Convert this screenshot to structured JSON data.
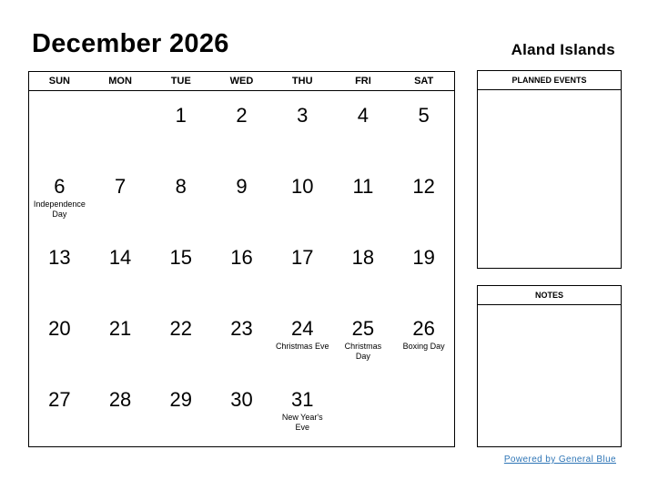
{
  "header": {
    "title": "December 2026",
    "country": "Aland Islands"
  },
  "weekdays": [
    "SUN",
    "MON",
    "TUE",
    "WED",
    "THU",
    "FRI",
    "SAT"
  ],
  "cells": [
    {
      "day": "",
      "holiday": ""
    },
    {
      "day": "",
      "holiday": ""
    },
    {
      "day": "1",
      "holiday": ""
    },
    {
      "day": "2",
      "holiday": ""
    },
    {
      "day": "3",
      "holiday": ""
    },
    {
      "day": "4",
      "holiday": ""
    },
    {
      "day": "5",
      "holiday": ""
    },
    {
      "day": "6",
      "holiday": "Independence Day"
    },
    {
      "day": "7",
      "holiday": ""
    },
    {
      "day": "8",
      "holiday": ""
    },
    {
      "day": "9",
      "holiday": ""
    },
    {
      "day": "10",
      "holiday": ""
    },
    {
      "day": "11",
      "holiday": ""
    },
    {
      "day": "12",
      "holiday": ""
    },
    {
      "day": "13",
      "holiday": ""
    },
    {
      "day": "14",
      "holiday": ""
    },
    {
      "day": "15",
      "holiday": ""
    },
    {
      "day": "16",
      "holiday": ""
    },
    {
      "day": "17",
      "holiday": ""
    },
    {
      "day": "18",
      "holiday": ""
    },
    {
      "day": "19",
      "holiday": ""
    },
    {
      "day": "20",
      "holiday": ""
    },
    {
      "day": "21",
      "holiday": ""
    },
    {
      "day": "22",
      "holiday": ""
    },
    {
      "day": "23",
      "holiday": ""
    },
    {
      "day": "24",
      "holiday": "Christmas Eve"
    },
    {
      "day": "25",
      "holiday": "Christmas Day"
    },
    {
      "day": "26",
      "holiday": "Boxing Day"
    },
    {
      "day": "27",
      "holiday": ""
    },
    {
      "day": "28",
      "holiday": ""
    },
    {
      "day": "29",
      "holiday": ""
    },
    {
      "day": "30",
      "holiday": ""
    },
    {
      "day": "31",
      "holiday": "New Year's Eve"
    },
    {
      "day": "",
      "holiday": ""
    },
    {
      "day": "",
      "holiday": ""
    }
  ],
  "panels": {
    "events_title": "PLANNED EVENTS",
    "notes_title": "NOTES"
  },
  "footer": {
    "powered_by": "Powered by General Blue",
    "link_color": "#2e75b6"
  }
}
